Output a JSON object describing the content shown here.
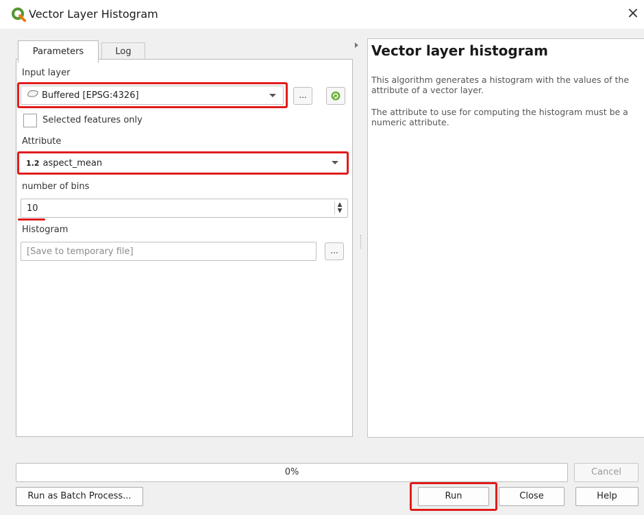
{
  "window": {
    "title": "Vector Layer Histogram",
    "close_glyph": "×"
  },
  "tabs": [
    {
      "label": "Parameters",
      "active": true
    },
    {
      "label": "Log",
      "active": false
    }
  ],
  "params": {
    "input_layer_label": "Input layer",
    "input_layer_value": "Buffered [EPSG:4326]",
    "browse_button": "...",
    "selected_only_label": "Selected features only",
    "selected_only_checked": false,
    "attribute_label": "Attribute",
    "attribute_type_badge": "1.2",
    "attribute_value": "aspect_mean",
    "bins_label": "number of bins",
    "bins_value": "10",
    "histogram_label": "Histogram",
    "histogram_placeholder": "[Save to temporary file]",
    "histogram_browse": "..."
  },
  "help": {
    "title": "Vector layer histogram",
    "p1": "This algorithm generates a histogram with the values of the attribute of a vector layer.",
    "p2": "The attribute to use for computing the histogram must be a numeric attribute."
  },
  "footer": {
    "progress_text": "0%",
    "progress_value": 0,
    "cancel_label": "Cancel",
    "batch_label": "Run as Batch Process...",
    "run_label": "Run",
    "close_label": "Close",
    "help_label": "Help"
  },
  "colors": {
    "highlight": "#e01b1b",
    "qgis_green": "#589632"
  }
}
